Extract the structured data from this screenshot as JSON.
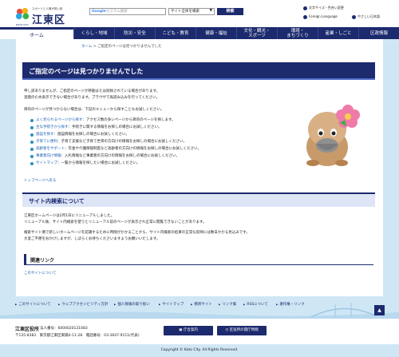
{
  "header": {
    "logo_tagline": "スポーツと人情が熱い街",
    "logo_name": "江東区",
    "logo_sub": "KOTO CITY",
    "search_brand": "Google",
    "search_placeholder": "カスタム検索",
    "scope_value": "サイト全体を検索",
    "search_button": "検索",
    "util_1": "文字サイズ・色合い変更",
    "util_2": "Foreign Language",
    "util_3": "やさしい日本語"
  },
  "nav": {
    "home": "ホーム",
    "items": [
      "くらし・地域",
      "防災・安全",
      "こども・教育",
      "健康・福祉",
      "文化・観光・\nスポーツ",
      "環境・\nまちづくり",
      "産業・しごと",
      "区政情報"
    ]
  },
  "breadcrumb": {
    "home": "ホーム",
    "sep": " > ",
    "current": "ご指定のページは見つかりませんでした"
  },
  "main": {
    "title": "ご指定のページは見つかりませんでした",
    "p1": "申し訳ありませんが、ご指定のページが移動または削除されている場合があります。",
    "p2": "混雑のため表示できない場合があります。ブラウザで再読み込みを行ってください。",
    "p3": "目的のページが見つからない場合は、下記のメニューから探すこともお試しください。",
    "list": [
      {
        "link": "よく見られるページから探す",
        "text": "：アクセス数の多いページから目的のページを探します。"
      },
      {
        "link": "主な手続きから探す",
        "text": "：手続きに関する情報をお探しの場合にお試しください。"
      },
      {
        "link": "施設を探す",
        "text": "：施設情報をお探しの場合にお試しください。"
      },
      {
        "link": "子育てに便利",
        "text": "：子育て支援など子育て世帯の方向けの情報をお探しの場合にお試しください。"
      },
      {
        "link": "高齢者をサポート",
        "text": "：年金や介護保険制度など高齢者の方向けの情報をお探しの場合にお試しください。"
      },
      {
        "link": "事業者向け情報",
        "text": "：入札情報など事業者の方向けの情報をお探しの場合にお試しください。"
      },
      {
        "link": "サイトマップ",
        "text": "：一覧から情報を探したい場合にお試しください。"
      }
    ],
    "top_link": "トップページへ戻る",
    "h2": "サイト内検索について",
    "s1": "江東区ホームページは2月1日にリニューアルしました。",
    "s2": "リニューアル後、サイト内検索を使うとリニューアル前のページが表示され正常に閲覧できないことがあります。",
    "s3": "検索サイト側で新しいホームページを認識するために時間がかかることから、サイト内検索の結果の正常な反映には数日かかる見込みです。",
    "s4": "大変ご不便をおかけしますが、しばらくお待ちくださいますようお願いいたします。",
    "h3": "関連リンク",
    "related": "このサイトについて"
  },
  "footer_links": [
    "このサイトについて",
    "ウェブアクセシビリティ方針",
    "個人情報の取り扱い",
    "サイトマップ",
    "携帯サイト",
    "リンク集",
    "RSSについて",
    "著作権・リンク"
  ],
  "footer": {
    "office": "江東区役所",
    "corp_no": "法人番号：6000020131083",
    "address": "〒135-8383　東京都江東区東陽4-11-28",
    "tel": "電話番号：03-3647-9111(代表)",
    "btn_guide": "庁舎案内",
    "btn_hours": "区役所の開庁時間",
    "copyright": "Copyright © Koto City. All Rights Reserved."
  },
  "colors": {
    "navy": "#1c2a6e",
    "link": "#1a5fb4",
    "bg": "#cfe7f5"
  }
}
